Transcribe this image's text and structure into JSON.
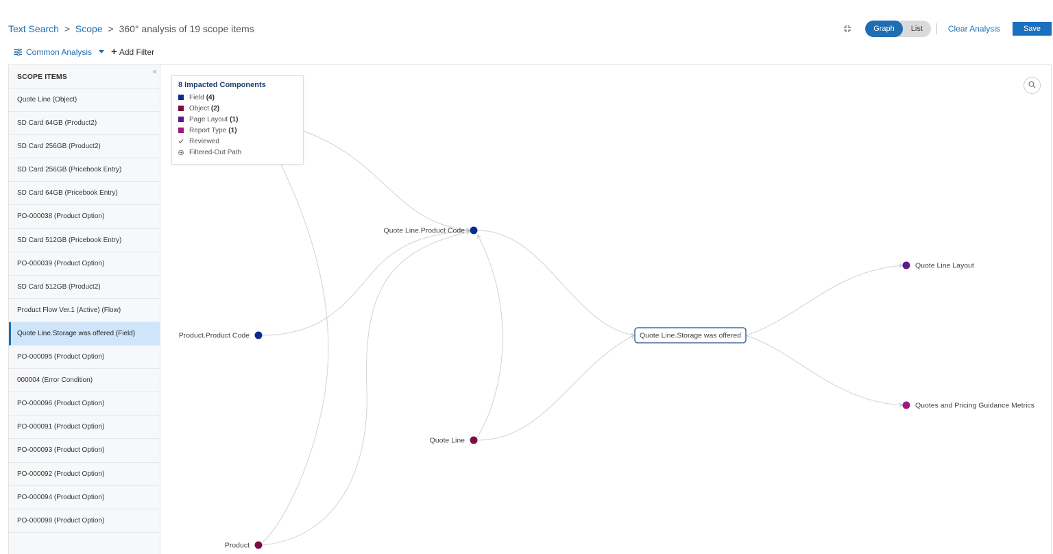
{
  "breadcrumb": {
    "text_search": "Text Search",
    "sep1": ">",
    "scope": "Scope",
    "sep2": ">",
    "current": "360° analysis of 19 scope items"
  },
  "toolbar": {
    "graph_label": "Graph",
    "list_label": "List",
    "active_view": "Graph",
    "clear_label": "Clear Analysis",
    "save_label": "Save"
  },
  "filters": {
    "analysis_label": "Common Analysis",
    "add_filter_label": "Add Filter"
  },
  "sidebar": {
    "title": "SCOPE ITEMS",
    "items": [
      {
        "label": "Quote Line (Object)"
      },
      {
        "label": "SD Card 64GB (Product2)"
      },
      {
        "label": "SD Card 256GB (Product2)"
      },
      {
        "label": "SD Card 256GB (Pricebook Entry)"
      },
      {
        "label": "SD Card 64GB (Pricebook Entry)"
      },
      {
        "label": "PO-000038 (Product Option)"
      },
      {
        "label": "SD Card 512GB (Pricebook Entry)"
      },
      {
        "label": "PO-000039 (Product Option)"
      },
      {
        "label": "SD Card 512GB (Product2)"
      },
      {
        "label": "Product Flow Ver.1 (Active) (Flow)"
      },
      {
        "label": "Quote Line.Storage was offered (Field)"
      },
      {
        "label": "PO-000095 (Product Option)"
      },
      {
        "label": "000004 (Error Condition)"
      },
      {
        "label": "PO-000096 (Product Option)"
      },
      {
        "label": "PO-000091 (Product Option)"
      },
      {
        "label": "PO-000093 (Product Option)"
      },
      {
        "label": "PO-000092 (Product Option)"
      },
      {
        "label": "PO-000094 (Product Option)"
      },
      {
        "label": "PO-000098 (Product Option)"
      }
    ],
    "selected_item": "Quote Line.Storage was offered (Field)"
  },
  "legend": {
    "title": "8 Impacted Components",
    "types": [
      {
        "label": "Field",
        "count": "(4)",
        "color": "#0b2c8f"
      },
      {
        "label": "Object",
        "count": "(2)",
        "color": "#7a0d44"
      },
      {
        "label": "Page Layout",
        "count": "(1)",
        "color": "#5e1a8c"
      },
      {
        "label": "Report Type",
        "count": "(1)",
        "color": "#a0187e"
      }
    ],
    "reviewed_label": "Reviewed",
    "filtered_label": "Filtered-Out Path"
  },
  "graph": {
    "nodes": {
      "product_code_ql": {
        "label": "Quote Line.Product Code",
        "color": "#0b2c8f"
      },
      "product_code": {
        "label": "Product.Product Code",
        "color": "#0b2c8f"
      },
      "quote_line": {
        "label": "Quote Line",
        "color": "#7a0d44"
      },
      "product": {
        "label": "Product",
        "color": "#7a0d44"
      },
      "storage_offered": {
        "label": "Quote Line.Storage was offered",
        "color": "#1d4e8f"
      },
      "ql_layout": {
        "label": "Quote Line Layout",
        "color": "#5e1a8c"
      },
      "pricing_metrics": {
        "label": "Quotes and Pricing Guidance Metrics",
        "color": "#a0187e"
      }
    }
  }
}
